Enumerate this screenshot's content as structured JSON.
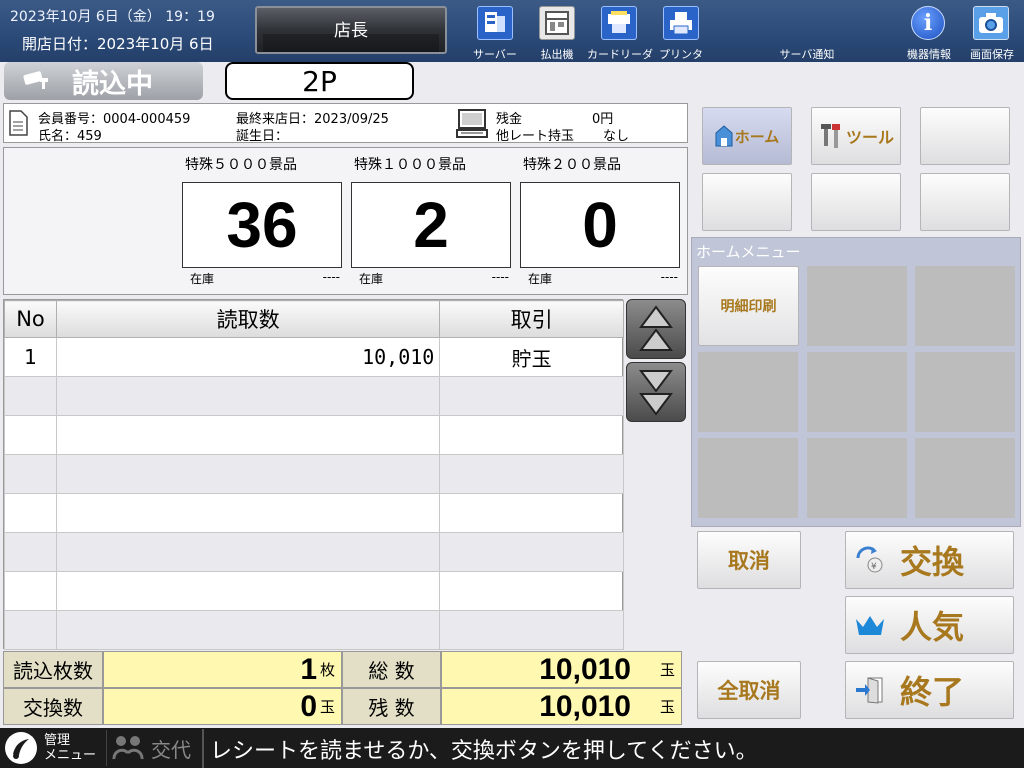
{
  "header": {
    "datetime": "2023年10月 6日（金）  19：19",
    "opening_date": "開店日付：2023年10月 6日",
    "operator": "店長",
    "toolbar": [
      {
        "label": "サーバー",
        "icon": "server-icon"
      },
      {
        "label": "払出機",
        "icon": "dispenser-icon"
      },
      {
        "label": "カードリーダ",
        "icon": "card-reader-icon"
      },
      {
        "label": "プリンタ",
        "icon": "printer-icon"
      },
      {
        "label": "サーバ通知",
        "icon": ""
      },
      {
        "label": "機器情報",
        "icon": "info-icon"
      },
      {
        "label": "画面保存",
        "icon": "camera-icon"
      }
    ]
  },
  "status": {
    "reading": "読込中",
    "player": "2P"
  },
  "member": {
    "member_no": "会員番号：0004-000459",
    "name": "氏名：459",
    "last_visit": "最終来店日：2023/09/25",
    "birthday": "誕生日：",
    "balance_label": "残金",
    "balance_value": "0円",
    "other_rate_label": "他レート持玉",
    "other_rate_value": "なし"
  },
  "prizes": [
    {
      "label": "特殊５０００景品",
      "count": "36",
      "stock_label": "在庫",
      "stock_value": "----"
    },
    {
      "label": "特殊１０００景品",
      "count": "2",
      "stock_label": "在庫",
      "stock_value": "----"
    },
    {
      "label": "特殊２００景品",
      "count": "0",
      "stock_label": "在庫",
      "stock_value": "----"
    }
  ],
  "table": {
    "headers": [
      "No",
      "読取数",
      "取引"
    ],
    "rows": [
      {
        "no": "1",
        "count": "10,010",
        "type": "貯玉"
      }
    ]
  },
  "summary": {
    "read_sheets_label": "読込枚数",
    "read_sheets_value": "1",
    "read_sheets_unit": "枚",
    "total_label": "総 数",
    "total_value": "10,010",
    "total_unit": "玉",
    "exchange_label": "交換数",
    "exchange_value": "0",
    "exchange_unit": "玉",
    "remain_label": "残 数",
    "remain_value": "10,010",
    "remain_unit": "玉"
  },
  "right": {
    "home": "ホーム",
    "tools": "ツール",
    "home_menu_title": "ホームメニュー",
    "detail_print": "明細印刷",
    "cancel": "取消",
    "cancel_all": "全取消",
    "exchange": "交換",
    "popular": "人気",
    "finish": "終了"
  },
  "footer": {
    "admin_menu_line1": "管理",
    "admin_menu_line2": "メニュー",
    "shift": "交代",
    "message": "レシートを読ませるか、交換ボタンを押してください。"
  }
}
